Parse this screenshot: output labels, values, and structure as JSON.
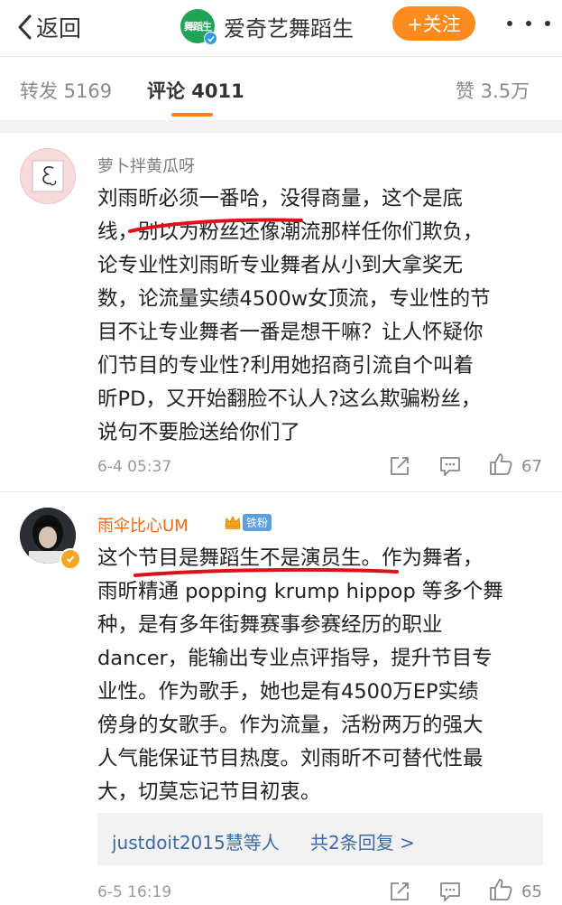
{
  "header": {
    "back_label": "返回",
    "account_logo_text": "舞蹈生",
    "title": "爱奇艺舞蹈生",
    "follow_label": "+关注"
  },
  "tabs": {
    "repost": "转发 5169",
    "comments": "评论 4011",
    "likes": "赞 3.5万"
  },
  "comments": [
    {
      "username": "萝卜拌黄瓜呀",
      "text_lines": [
        "刘雨昕必须一番哈，没得商量，这个是底",
        "线，别以为粉丝还像潮流那样任你们欺负，",
        "论专业性刘雨昕专业舞者从小到大拿奖无",
        "数，论流量实绩4500w女顶流，专业性的节",
        "目不让专业舞者一番是想干嘛？让人怀疑你",
        "们节目的专业性?利用她招商引流自个叫着",
        "昕PD，又开始翻脸不认人?这么欺骗粉丝，",
        "说句不要脸送给你们了"
      ],
      "time": "6-4 05:37",
      "likes": "67"
    },
    {
      "username": "雨伞比心UM",
      "fan_badge": "铁粉",
      "text_lines": [
        "这个节目是舞蹈生不是演员生。作为舞者，",
        "雨昕精通 popping krump hippop 等多个舞",
        "种，是有多年街舞赛事参赛经历的职业",
        "dancer，能输出专业点评指导，提升节目专",
        "业性。作为歌手，她也是有4500万EP实绩",
        "傍身的女歌手。作为流量，活粉两万的强大",
        "人气能保证节目热度。刘雨昕不可替代性最",
        "大，切莫忘记节目初衷。"
      ],
      "reply_users": "justdoit2015慧等人",
      "reply_count": "共2条回复 >",
      "time": "6-5 16:19",
      "likes": "65"
    }
  ],
  "colors": {
    "accent_orange": "#ff8200",
    "follow_button": "#fb8c1d",
    "username_highlight": "#e86a14",
    "link_blue": "#3b6aa8",
    "annotation_red": "#e0101a"
  }
}
